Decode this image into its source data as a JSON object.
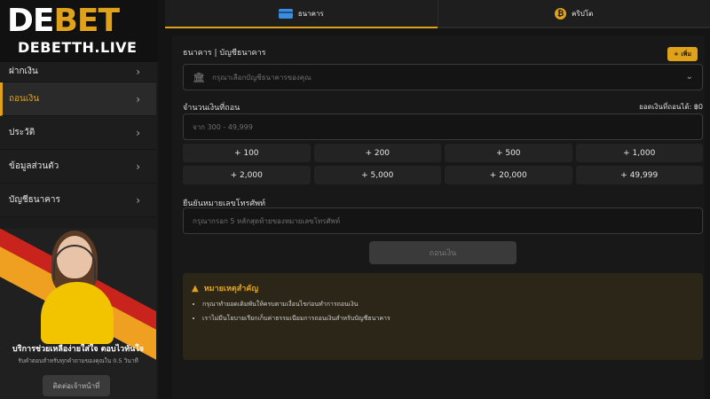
{
  "logo": {
    "brand_main": "DE",
    "brand_accent": "BET",
    "domain": "DEBETTH.LIVE"
  },
  "sidebar": {
    "items": [
      {
        "label": "ฝากเงิน",
        "active": false
      },
      {
        "label": "ถอนเงิน",
        "active": true
      },
      {
        "label": "ประวัติ",
        "active": false
      },
      {
        "label": "ข้อมูลส่วนตัว",
        "active": false
      },
      {
        "label": "บัญชีธนาคาร",
        "active": false
      }
    ],
    "support": {
      "title": "บริการช่วยเหลือง่ายใส่ใจ ตอบไวทันใจ",
      "subtitle": "รับคำตอบสำหรับทุกคำถามของคุณใน 0.5 วินาที",
      "button": "ติดต่อเจ้าหน้าที่"
    }
  },
  "tabs": [
    {
      "label": "ธนาคาร",
      "icon": "bank-card-icon",
      "active": true
    },
    {
      "label": "คริปโต",
      "icon": "bitcoin-icon",
      "active": false
    }
  ],
  "form": {
    "account_label": "ธนาคาร | บัญชีธนาคาร",
    "add_button": "+ เพิ่ม",
    "account_placeholder": "กรุณาเลือกบัญชีธนาคารของคุณ",
    "amount_label": "จำนวนเงินที่ถอน",
    "balance_label": "ยอดเงินที่ถอนได้: ฿0",
    "amount_placeholder": "จาก 300 - 49,999",
    "quick_amounts": [
      "+ 100",
      "+ 200",
      "+ 500",
      "+ 1,000",
      "+ 2,000",
      "+ 5,000",
      "+ 20,000",
      "+ 49,999"
    ],
    "phone_label": "ยืนยันหมายเลขโทรศัพท์",
    "phone_placeholder": "กรุณากรอก 5 หลักสุดท้ายของหมายเลขโทรศัพท์",
    "submit": "ถอนเงิน"
  },
  "notice": {
    "title": "หมายเหตุสำคัญ",
    "items": [
      "กรุณาทำยอดเดิมพันให้ครบตามเงื่อนไขก่อนทำการถอนเงิน",
      "เราไม่มีนโยบายเรียกเก็บค่าธรรมเนียมการถอนเงินสำหรับบัญชีธนาคาร"
    ]
  },
  "colors": {
    "accent": "#e0a21b",
    "background": "#141414"
  }
}
